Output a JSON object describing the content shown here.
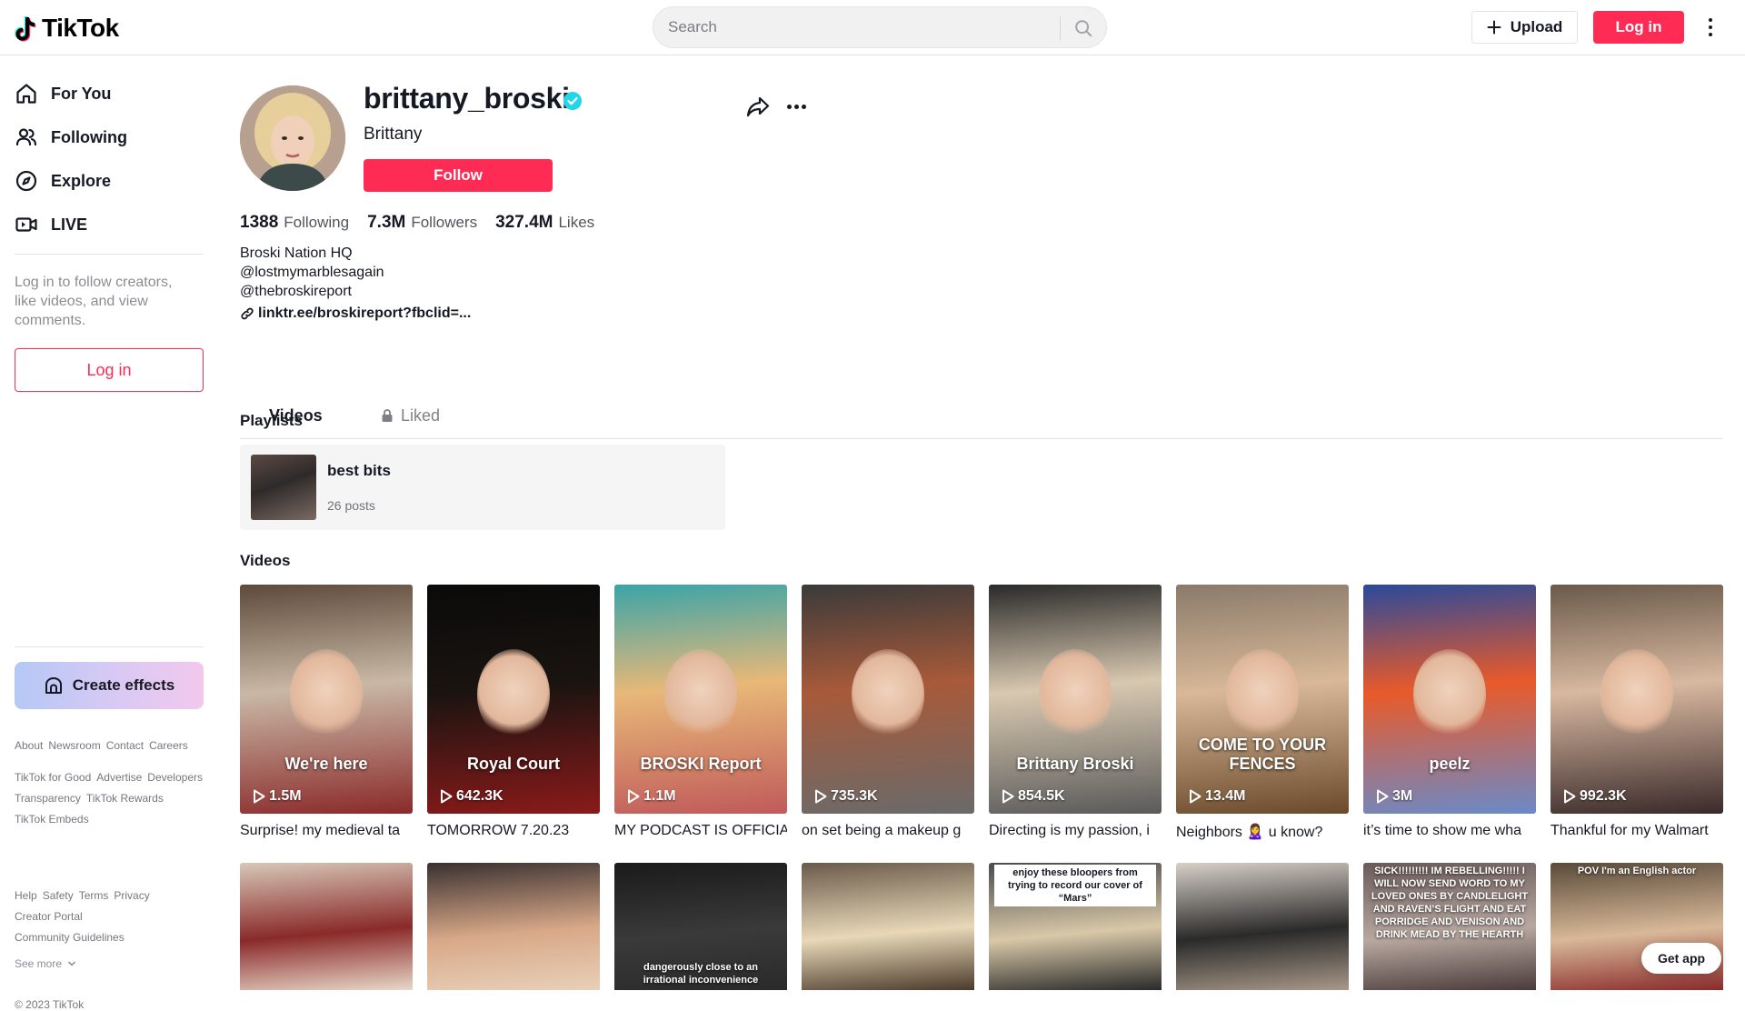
{
  "header": {
    "logo_text": "TikTok",
    "search_placeholder": "Search",
    "upload_label": "Upload",
    "login_label": "Log in"
  },
  "sidebar": {
    "nav": [
      {
        "label": "For You",
        "icon": "home-icon"
      },
      {
        "label": "Following",
        "icon": "people-icon"
      },
      {
        "label": "Explore",
        "icon": "compass-icon"
      },
      {
        "label": "LIVE",
        "icon": "live-camera-icon"
      }
    ],
    "login_hint": "Log in to follow creators, like videos, and view comments.",
    "login_button": "Log in",
    "create_effects": "Create effects",
    "footer_links_1": [
      "About",
      "Newsroom",
      "Contact",
      "Careers"
    ],
    "footer_links_2": [
      "TikTok for Good",
      "Advertise",
      "Developers",
      "Transparency",
      "TikTok Rewards",
      "TikTok Embeds"
    ],
    "footer_links_3": [
      "Help",
      "Safety",
      "Terms",
      "Privacy",
      "Creator Portal",
      "Community Guidelines"
    ],
    "see_more": "See more",
    "copyright": "© 2023 TikTok"
  },
  "profile": {
    "username": "brittany_broski",
    "nickname": "Brittany",
    "follow_label": "Follow",
    "stats": [
      {
        "value": "1388",
        "label": "Following"
      },
      {
        "value": "7.3M",
        "label": "Followers"
      },
      {
        "value": "327.4M",
        "label": "Likes"
      }
    ],
    "bio_lines": [
      "Broski Nation HQ",
      "@lostmymarblesagain",
      "@thebroskireport"
    ],
    "link": "linktr.ee/broskireport?fbclid=..."
  },
  "tabs": {
    "videos": "Videos",
    "liked": "Liked"
  },
  "playlists": {
    "title": "Playlists",
    "items": [
      {
        "name": "best bits",
        "count": "26 posts"
      }
    ]
  },
  "videos": {
    "title": "Videos",
    "row1": [
      {
        "views": "1.5M",
        "caption": "Surprise! my medieval ta",
        "overlay": "We're here",
        "colors": [
          "#5d4a3a",
          "#c9b8a6",
          "#8a2a2a"
        ]
      },
      {
        "views": "642.3K",
        "caption": "TOMORROW 7.20.23",
        "overlay": "Royal Court",
        "colors": [
          "#0a0a0a",
          "#1a1410",
          "#8a1a1a"
        ]
      },
      {
        "views": "1.1M",
        "caption": "MY PODCAST IS OFFICIA",
        "overlay": "BROSKI Report",
        "colors": [
          "#3aa4a8",
          "#e8b878",
          "#c05a5a"
        ]
      },
      {
        "views": "735.3K",
        "caption": "on set being a makeup g",
        "overlay": "",
        "colors": [
          "#3a3a3a",
          "#a85a3a",
          "#6a6a6a"
        ]
      },
      {
        "views": "854.5K",
        "caption": "Directing is my passion, i",
        "overlay": "Brittany Broski",
        "colors": [
          "#2a2a2a",
          "#d8c8b0",
          "#5a5a5a"
        ]
      },
      {
        "views": "13.4M",
        "caption": "Neighbors 🙎‍♀️ u know?",
        "overlay": "COME TO YOUR FENCES",
        "colors": [
          "#8a7a6a",
          "#d8b898",
          "#6a4a2a"
        ]
      },
      {
        "views": "3M",
        "caption": "it’s time to show me wha",
        "overlay": "peelz",
        "colors": [
          "#2a4a9a",
          "#e85a2a",
          "#6a8ac8"
        ]
      },
      {
        "views": "992.3K",
        "caption": "Thankful for my Walmart",
        "overlay": "",
        "colors": [
          "#6a5a4a",
          "#d8b8a0",
          "#3a2a2a"
        ]
      }
    ],
    "row2": [
      {
        "overlay": "",
        "colors": [
          "#d8c8b8",
          "#8a2a2a",
          "#e8d8c8"
        ]
      },
      {
        "overlay": "",
        "colors": [
          "#3a3030",
          "#d8a888",
          "#e8d0b8"
        ]
      },
      {
        "overlay": "dangerously close to an irrational inconvenience",
        "colors": [
          "#1a1a1a",
          "#3a3a3a",
          "#2a2a2a"
        ]
      },
      {
        "overlay": "",
        "colors": [
          "#6a5a4a",
          "#e8d8b8",
          "#4a3a2a"
        ]
      },
      {
        "overlay": "enjoy these bloopers from trying to record our cover of “Mars”",
        "colors": [
          "#4a4a4a",
          "#d8c8a8",
          "#2a2a2a"
        ]
      },
      {
        "overlay": "",
        "colors": [
          "#d8d0c8",
          "#2a2a2a",
          "#a89888"
        ]
      },
      {
        "overlay": "SICK!!!!!!!!! IM REBELLING!!!!! I WILL NOW SEND WORD TO MY LOVED ONES BY CANDLELIGHT AND RAVEN’S FLIGHT AND EAT PORRIDGE AND VENISON AND DRINK MEAD BY THE HEARTH",
        "colors": [
          "#6a5a5a",
          "#b8a8a0",
          "#4a3a3a"
        ]
      },
      {
        "overlay": "POV I'm an English actor",
        "colors": [
          "#5a4a3a",
          "#d8b898",
          "#8a2a2a"
        ]
      }
    ]
  },
  "get_app": "Get app",
  "colors": {
    "accent": "#fe2c55",
    "verified": "#20d5ec"
  }
}
